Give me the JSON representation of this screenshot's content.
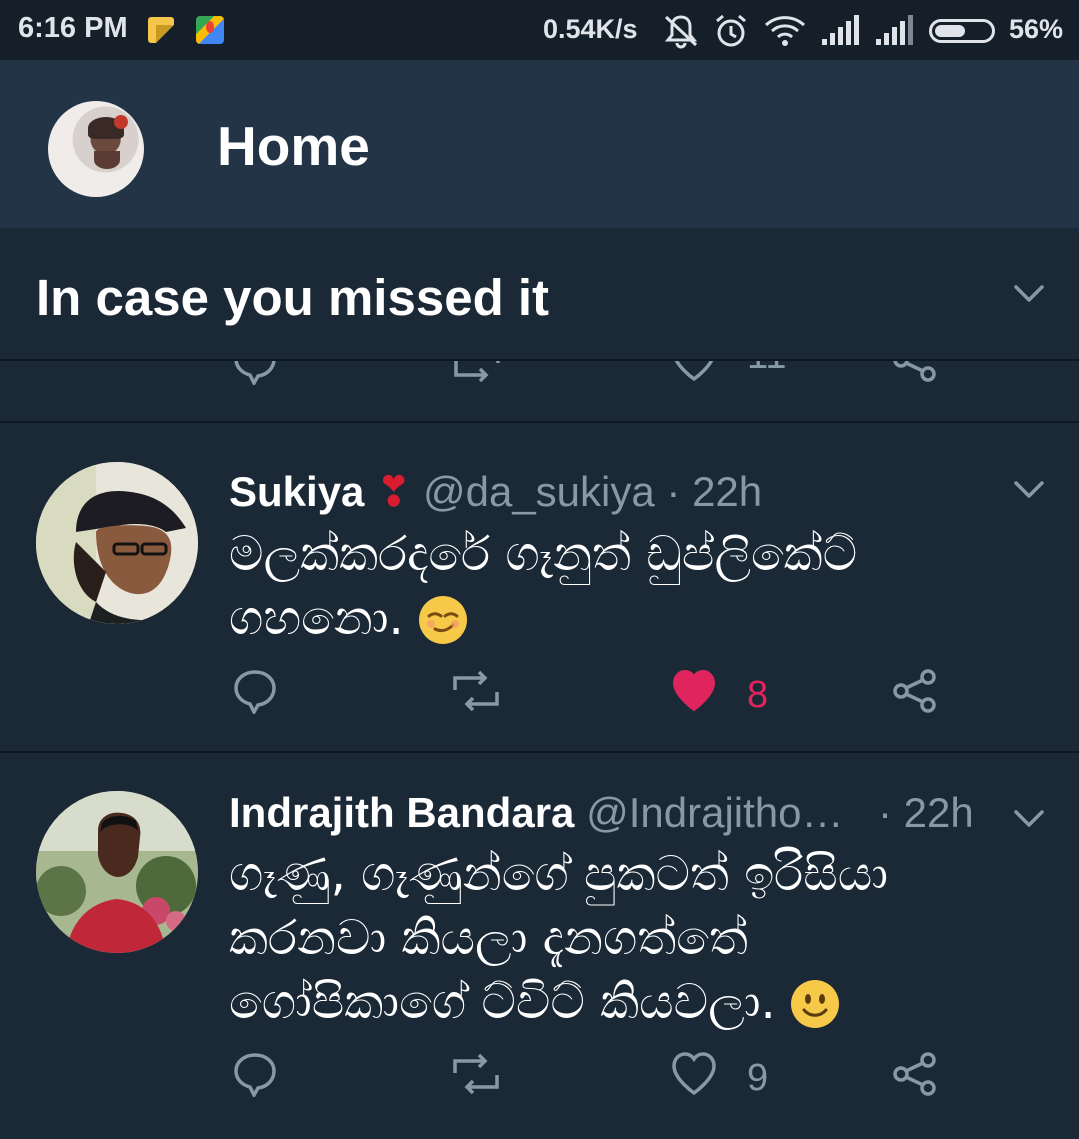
{
  "status_bar": {
    "time": "6:16 PM",
    "net_speed": "0.54K/s",
    "battery_percent": "56%",
    "battery_level": 0.56
  },
  "header": {
    "title": "Home"
  },
  "section": {
    "title": "In case you missed it"
  },
  "tweets": [
    {
      "name": "Sukiya",
      "badge": "❣",
      "handle": "@da_sukiya",
      "separator": "·",
      "time": "22h",
      "text_line1": "මලක්කරදරේ ගෑනුත් ඩුප්ලිකේට්",
      "text_line2": "ගහනො.",
      "emoji": "smirk-emoji",
      "likes": "8",
      "liked": true
    },
    {
      "name": "Indrajith Bandara",
      "handle": "@Indrajitho…",
      "separator": "·",
      "time": "22h",
      "text_line1": "ගෑණු, ගෑණුන්ගේ පුකටත් ඉරිසියා",
      "text_line2": "කරනවා කියලා දැනගත්තේ",
      "text_line3": "ගෝපිකාගේ ට්විට් කියවලා.",
      "emoji": "smile-emoji",
      "likes": "9",
      "liked": false
    }
  ],
  "colors": {
    "background": "#1b2836",
    "header": "#243447",
    "muted": "#8899a6",
    "like": "#e0245e"
  }
}
